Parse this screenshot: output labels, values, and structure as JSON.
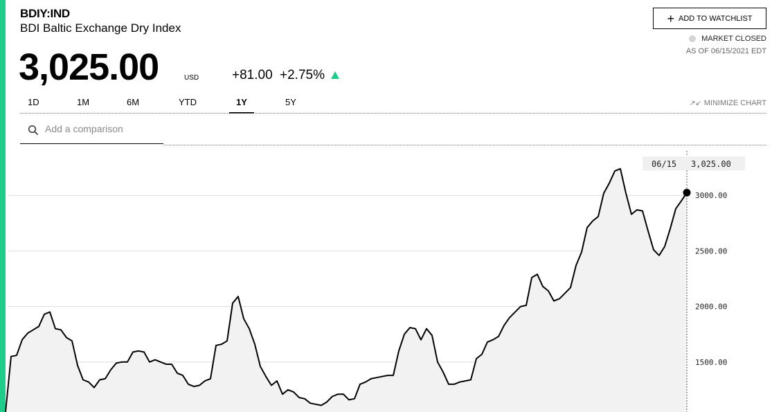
{
  "header": {
    "ticker": "BDIY:IND",
    "name": "BDI Baltic Exchange Dry Index",
    "price": "3,025.00",
    "currency": "USD",
    "change": "+81.00",
    "change_pct": "+2.75%",
    "direction_icon": "triangle-up-icon",
    "accent_color": "#1fcc8a"
  },
  "watchlist": {
    "icon": "plus-icon",
    "label": "ADD TO WATCHLIST"
  },
  "status": {
    "label": "MARKET CLOSED",
    "asof": "AS OF 06/15/2021 EDT"
  },
  "tabs": [
    {
      "label": "1D",
      "active": false
    },
    {
      "label": "1M",
      "active": false
    },
    {
      "label": "6M",
      "active": false
    },
    {
      "label": "YTD",
      "active": false
    },
    {
      "label": "1Y",
      "active": true
    },
    {
      "label": "5Y",
      "active": false
    }
  ],
  "minimize": {
    "icon": "minimize-arrows-icon",
    "label": "MINIMIZE CHART"
  },
  "search": {
    "icon": "search-icon",
    "placeholder": "Add a comparison"
  },
  "tooltip": {
    "date": "06/15",
    "value": "3,025.00"
  },
  "chart_data": {
    "type": "area",
    "ylim": [
      1050,
      3450
    ],
    "y_ticks": [
      {
        "value": 1500,
        "label": "1500.00"
      },
      {
        "value": 2000,
        "label": "2000.00"
      },
      {
        "value": 2500,
        "label": "2500.00"
      },
      {
        "value": 3000,
        "label": "3000.00"
      }
    ],
    "grid": true,
    "line_color": "#000000",
    "fill_color": "#f2f2f2",
    "series": [
      {
        "values": [
          1050,
          1550,
          1560,
          1700,
          1760,
          1790,
          1820,
          1930,
          1950,
          1800,
          1790,
          1720,
          1690,
          1470,
          1340,
          1320,
          1270,
          1340,
          1350,
          1430,
          1490,
          1500,
          1500,
          1590,
          1600,
          1590,
          1500,
          1520,
          1500,
          1480,
          1480,
          1400,
          1380,
          1300,
          1280,
          1290,
          1330,
          1350,
          1650,
          1660,
          1690,
          2030,
          2090,
          1890,
          1800,
          1660,
          1460,
          1370,
          1290,
          1330,
          1210,
          1250,
          1230,
          1180,
          1170,
          1130,
          1120,
          1110,
          1140,
          1190,
          1210,
          1210,
          1160,
          1170,
          1300,
          1320,
          1350,
          1360,
          1370,
          1380,
          1380,
          1600,
          1750,
          1810,
          1800,
          1700,
          1800,
          1740,
          1500,
          1410,
          1300,
          1300,
          1320,
          1330,
          1340,
          1530,
          1570,
          1680,
          1700,
          1730,
          1830,
          1900,
          1950,
          2000,
          2010,
          2260,
          2290,
          2180,
          2140,
          2050,
          2070,
          2120,
          2170,
          2370,
          2490,
          2710,
          2770,
          2810,
          3020,
          3110,
          3220,
          3240,
          3020,
          2830,
          2870,
          2860,
          2680,
          2510,
          2460,
          2540,
          2700,
          2880,
          2950,
          3025
        ]
      }
    ],
    "last_point": {
      "date": "06/15",
      "value": 3025
    }
  }
}
